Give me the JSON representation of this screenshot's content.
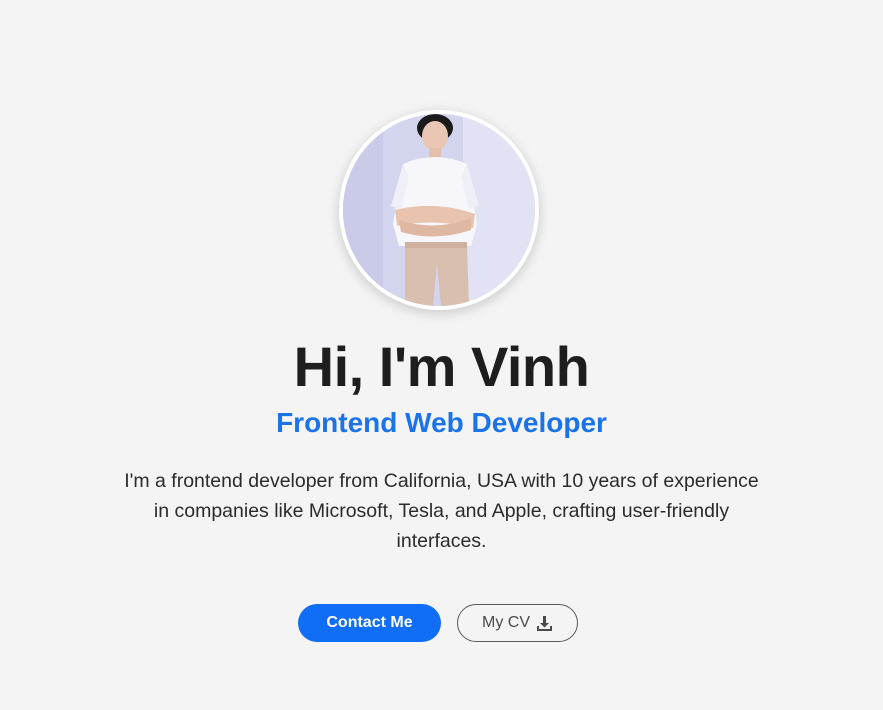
{
  "hero": {
    "title": "Hi, I'm Vinh",
    "subtitle": "Frontend Web Developer",
    "description": "I'm a frontend developer from California, USA with 10 years of experience in companies like Microsoft, Tesla, and Apple, crafting user-friendly interfaces.",
    "contact_button": "Contact Me",
    "cv_button": "My CV",
    "cv_icon": "download-icon",
    "accent_color": "#1a73e8",
    "button_color": "#0f6ef5"
  }
}
